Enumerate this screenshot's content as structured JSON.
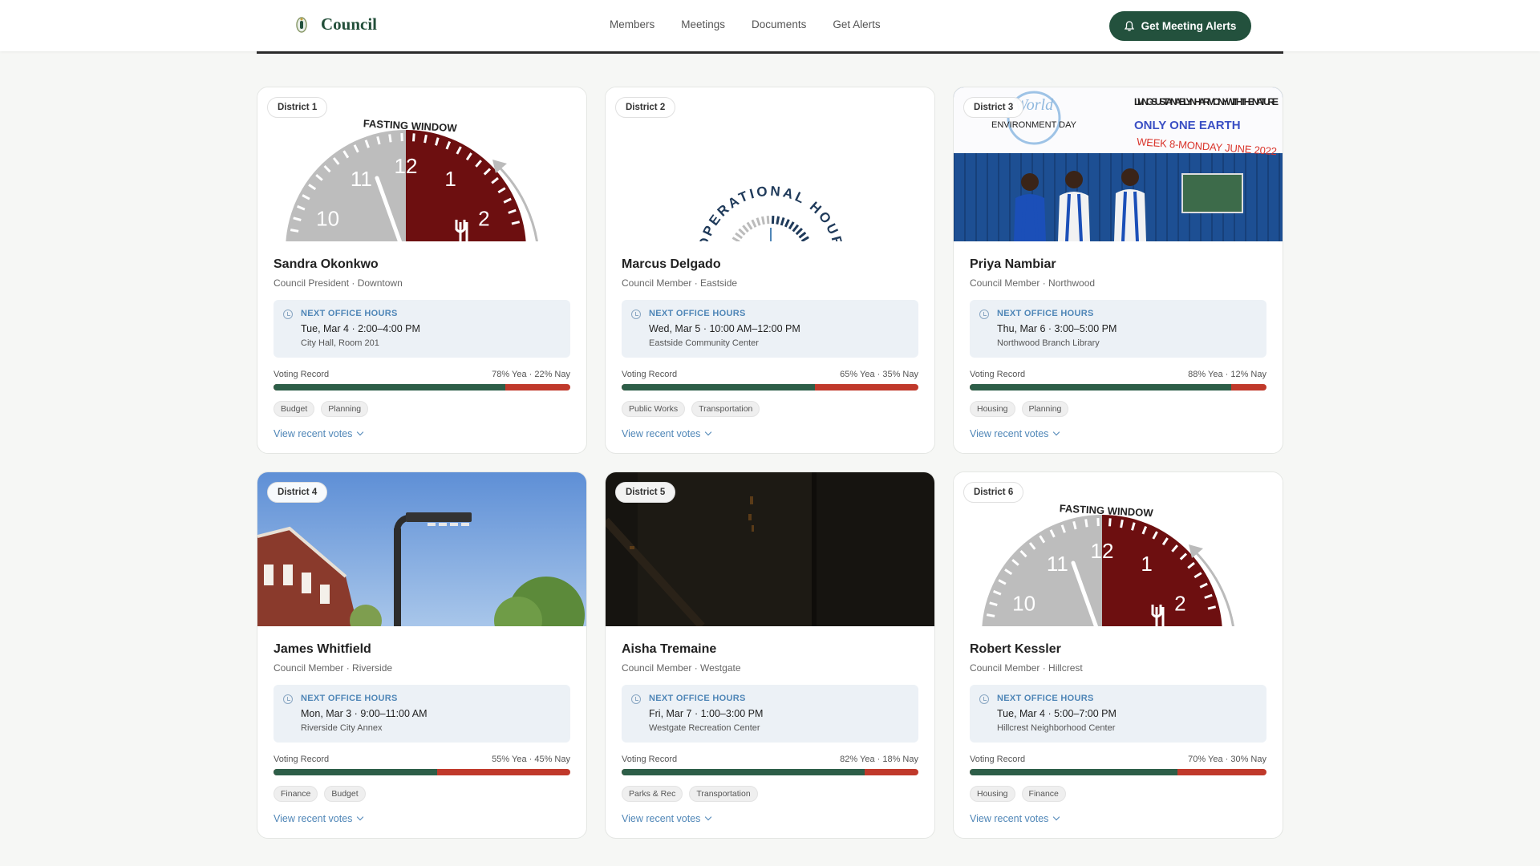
{
  "header": {
    "brand": "Council",
    "nav": [
      "Members",
      "Meetings",
      "Documents",
      "Get Alerts"
    ],
    "cta": "Get Meeting Alerts"
  },
  "labels": {
    "office_hours": "NEXT OFFICE HOURS",
    "voting_record": "Voting Record",
    "view_votes": "View recent votes"
  },
  "media_text": {
    "fasting_window": "FASTING WINDOW",
    "operational_hour": "OPERATIONAL HOUR",
    "clock_numbers": [
      "10",
      "11",
      "12",
      "1",
      "2"
    ],
    "banner_lines": [
      "World",
      "ENVIRONMENT DAY",
      "LIVING SUSTAINABLY IN HARMONY WITH THE NATURE",
      "ONLY ONE EARTH",
      "WEEK 8-MONDAY JUNE 2022"
    ]
  },
  "members": [
    {
      "district": "District 1",
      "name": "Sandra Okonkwo",
      "role": "Council President · Downtown",
      "hours_time": "Tue, Mar 4 · 2:00–4:00 PM",
      "hours_location": "City Hall, Room 201",
      "yea_pct": 78,
      "vote_text": "78% Yea · 22% Nay",
      "tags": [
        "Budget",
        "Planning"
      ],
      "media": "clock"
    },
    {
      "district": "District 2",
      "name": "Marcus Delgado",
      "role": "Council Member · Eastside",
      "hours_time": "Wed, Mar 5 · 10:00 AM–12:00 PM",
      "hours_location": "Eastside Community Center",
      "yea_pct": 65,
      "vote_text": "65% Yea · 35% Nay",
      "tags": [
        "Public Works",
        "Transportation"
      ],
      "media": "gauge"
    },
    {
      "district": "District 3",
      "name": "Priya Nambiar",
      "role": "Council Member · Northwood",
      "hours_time": "Thu, Mar 6 · 3:00–5:00 PM",
      "hours_location": "Northwood Branch Library",
      "yea_pct": 88,
      "vote_text": "88% Yea · 12% Nay",
      "tags": [
        "Housing",
        "Planning"
      ],
      "media": "banner"
    },
    {
      "district": "District 4",
      "name": "James Whitfield",
      "role": "Council Member · Riverside",
      "hours_time": "Mon, Mar 3 · 9:00–11:00 AM",
      "hours_location": "Riverside City Annex",
      "yea_pct": 55,
      "vote_text": "55% Yea · 45% Nay",
      "tags": [
        "Finance",
        "Budget"
      ],
      "media": "street"
    },
    {
      "district": "District 5",
      "name": "Aisha Tremaine",
      "role": "Council Member · Westgate",
      "hours_time": "Fri, Mar 7 · 1:00–3:00 PM",
      "hours_location": "Westgate Recreation Center",
      "yea_pct": 82,
      "vote_text": "82% Yea · 18% Nay",
      "tags": [
        "Parks & Rec",
        "Transportation"
      ],
      "media": "night"
    },
    {
      "district": "District 6",
      "name": "Robert Kessler",
      "role": "Council Member · Hillcrest",
      "hours_time": "Tue, Mar 4 · 5:00–7:00 PM",
      "hours_location": "Hillcrest Neighborhood Center",
      "yea_pct": 70,
      "vote_text": "70% Yea · 30% Nay",
      "tags": [
        "Housing",
        "Finance"
      ],
      "media": "clock"
    }
  ]
}
